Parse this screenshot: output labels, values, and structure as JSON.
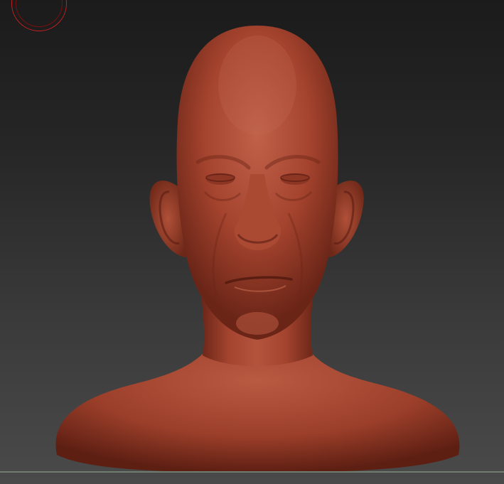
{
  "viewport": {
    "background_top": "#1b1b1b",
    "background_bottom": "#4a4a4a"
  },
  "model": {
    "material_color": "#a5452f",
    "shadow_color": "#5a1d12",
    "highlight_color": "#c46a52"
  },
  "brush_cursor": {
    "color": "#c22020"
  },
  "floor_line": {
    "color": "#6f7d6f"
  }
}
